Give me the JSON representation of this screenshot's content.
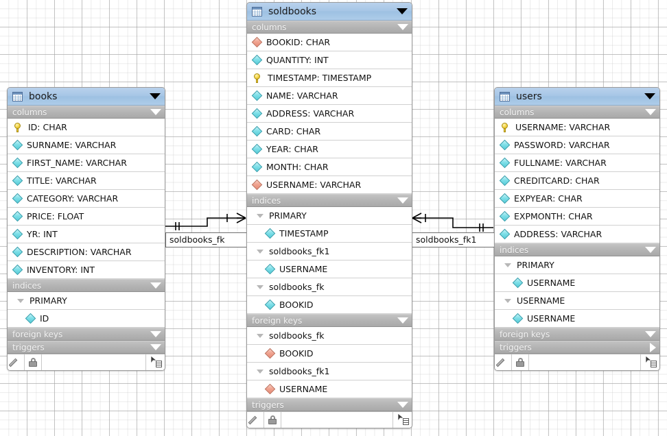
{
  "app": {
    "kind": "er-diagram-canvas"
  },
  "tables": [
    {
      "id": "books",
      "name": "books",
      "icon": "table-icon",
      "collapse_icon": "chevron-down-icon",
      "sections": {
        "columns": "columns",
        "indices": "indices",
        "foreign_keys": "foreign keys",
        "triggers": "triggers"
      },
      "columns": [
        {
          "label": "ID: CHAR",
          "marker": "primary-key"
        },
        {
          "label": "SURNAME: VARCHAR",
          "marker": "column"
        },
        {
          "label": "FIRST_NAME: VARCHAR",
          "marker": "column"
        },
        {
          "label": "TITLE: VARCHAR",
          "marker": "column"
        },
        {
          "label": "CATEGORY: VARCHAR",
          "marker": "column"
        },
        {
          "label": "PRICE: FLOAT",
          "marker": "column"
        },
        {
          "label": "YR: INT",
          "marker": "column"
        },
        {
          "label": "DESCRIPTION: VARCHAR",
          "marker": "column"
        },
        {
          "label": "INVENTORY: INT",
          "marker": "column"
        }
      ],
      "indices": [
        {
          "label": "PRIMARY",
          "marker": "group"
        },
        {
          "label": "ID",
          "marker": "column",
          "indent": true
        }
      ],
      "foreign_keys": [],
      "triggers": [],
      "triggers_expanded": true,
      "footer": {
        "edit": "pencil-icon",
        "lock": "lock-icon",
        "select": "cursor-list-icon"
      }
    },
    {
      "id": "soldbooks",
      "name": "soldbooks",
      "icon": "table-icon",
      "collapse_icon": "chevron-down-icon",
      "sections": {
        "columns": "columns",
        "indices": "indices",
        "foreign_keys": "foreign keys",
        "triggers": "triggers"
      },
      "columns": [
        {
          "label": "BOOKID: CHAR",
          "marker": "foreign-key"
        },
        {
          "label": "QUANTITY: INT",
          "marker": "column"
        },
        {
          "label": "TIMESTAMP: TIMESTAMP",
          "marker": "primary-key"
        },
        {
          "label": "NAME: VARCHAR",
          "marker": "column"
        },
        {
          "label": "ADDRESS: VARCHAR",
          "marker": "column"
        },
        {
          "label": "CARD: CHAR",
          "marker": "column"
        },
        {
          "label": "YEAR: CHAR",
          "marker": "column"
        },
        {
          "label": "MONTH: CHAR",
          "marker": "column"
        },
        {
          "label": "USERNAME: VARCHAR",
          "marker": "foreign-key"
        }
      ],
      "indices": [
        {
          "label": "PRIMARY",
          "marker": "group"
        },
        {
          "label": "TIMESTAMP",
          "marker": "column",
          "indent": true
        },
        {
          "label": "soldbooks_fk1",
          "marker": "group"
        },
        {
          "label": "USERNAME",
          "marker": "column",
          "indent": true
        },
        {
          "label": "soldbooks_fk",
          "marker": "group"
        },
        {
          "label": "BOOKID",
          "marker": "column",
          "indent": true
        }
      ],
      "foreign_keys": [
        {
          "label": "soldbooks_fk",
          "marker": "group"
        },
        {
          "label": "BOOKID",
          "marker": "foreign-key",
          "indent": true
        },
        {
          "label": "soldbooks_fk1",
          "marker": "group"
        },
        {
          "label": "USERNAME",
          "marker": "foreign-key",
          "indent": true
        }
      ],
      "triggers": [],
      "triggers_expanded": true,
      "footer": {
        "edit": "pencil-icon",
        "lock": "lock-icon",
        "select": "cursor-list-icon"
      }
    },
    {
      "id": "users",
      "name": "users",
      "icon": "table-icon",
      "collapse_icon": "chevron-down-icon",
      "sections": {
        "columns": "columns",
        "indices": "indices",
        "foreign_keys": "foreign keys",
        "triggers": "triggers"
      },
      "columns": [
        {
          "label": "USERNAME: VARCHAR",
          "marker": "primary-key"
        },
        {
          "label": "PASSWORD: VARCHAR",
          "marker": "column"
        },
        {
          "label": "FULLNAME: VARCHAR",
          "marker": "column"
        },
        {
          "label": "CREDITCARD: CHAR",
          "marker": "column"
        },
        {
          "label": "EXPYEAR: CHAR",
          "marker": "column"
        },
        {
          "label": "EXPMONTH: CHAR",
          "marker": "column"
        },
        {
          "label": "ADDRESS: VARCHAR",
          "marker": "column"
        }
      ],
      "indices": [
        {
          "label": "PRIMARY",
          "marker": "group"
        },
        {
          "label": "USERNAME",
          "marker": "column",
          "indent": true
        },
        {
          "label": "USERNAME",
          "marker": "group"
        },
        {
          "label": "USERNAME",
          "marker": "column",
          "indent": true
        }
      ],
      "foreign_keys": [],
      "triggers": [],
      "triggers_expanded": false,
      "footer": {
        "edit": "pencil-icon",
        "lock": "lock-icon",
        "select": "cursor-list-icon"
      }
    }
  ],
  "relationships": [
    {
      "id": "rel-soldbooks-fk",
      "label": "soldbooks_fk",
      "from": "books",
      "to": "soldbooks"
    },
    {
      "id": "rel-soldbooks-fk1",
      "label": "soldbooks_fk1",
      "from": "soldbooks",
      "to": "users"
    }
  ],
  "colors": {
    "title_bar": "#a6c6e6",
    "section_bar": "#b4b4b4",
    "column_marker": "#7fdfe8",
    "fk_marker": "#f0a491",
    "pk_marker": "#f2cf3c",
    "canvas": "#ffffff",
    "grid": "#a0a0a0"
  }
}
